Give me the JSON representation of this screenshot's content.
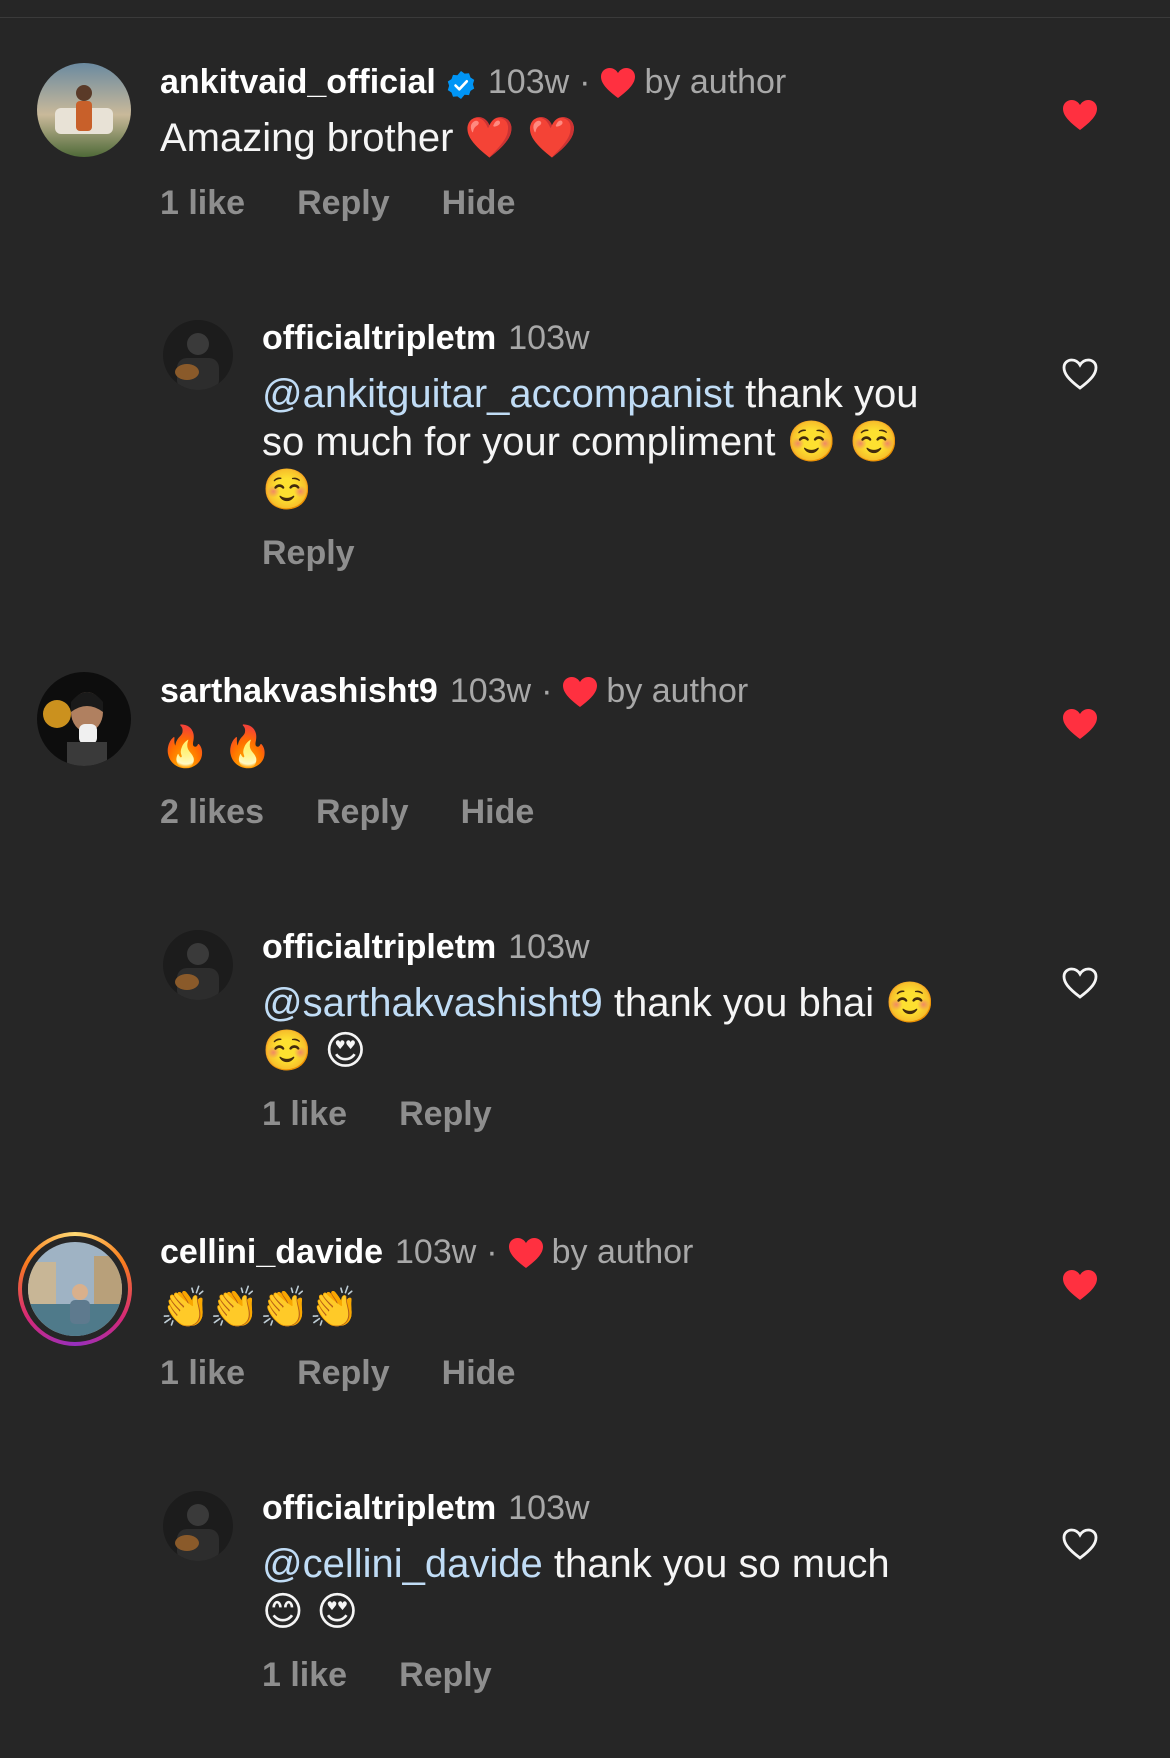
{
  "comments": [
    {
      "username": "ankitvaid_official",
      "verified": true,
      "time": "103w",
      "dot": "·",
      "by_author": "by author",
      "text": "Amazing brother",
      "emojis": "❤️ ❤️",
      "likes": "1 like",
      "reply": "Reply",
      "hide": "Hide",
      "liked": true,
      "replies": [
        {
          "username": "officialtripletm",
          "time": "103w",
          "mention": "@ankitguitar_accompanist",
          "text_line1": " thank you",
          "text_line2": "so much for your compliment",
          "emojis_line2": "☺️ ☺️",
          "emojis_line3": "☺️",
          "reply": "Reply",
          "liked": false
        }
      ]
    },
    {
      "username": "sarthakvashisht9",
      "time": "103w",
      "dot": "·",
      "by_author": "by author",
      "emojis": "🔥 🔥",
      "likes": "2 likes",
      "reply": "Reply",
      "hide": "Hide",
      "liked": true,
      "replies": [
        {
          "username": "officialtripletm",
          "time": "103w",
          "mention": "@sarthakvashisht9",
          "text_line1": " thank you bhai",
          "emojis_line1": "☺️",
          "emojis_line2": "☺️ 😍",
          "likes": "1 like",
          "reply": "Reply",
          "liked": false
        }
      ]
    },
    {
      "username": "cellini_davide",
      "time": "103w",
      "dot": "·",
      "by_author": "by author",
      "emojis": "👏👏👏👏",
      "likes": "1 like",
      "reply": "Reply",
      "hide": "Hide",
      "liked": true,
      "story_ring": true,
      "replies": [
        {
          "username": "officialtripletm",
          "time": "103w",
          "mention": "@cellini_davide",
          "text_line1": " thank you so much",
          "emojis_line2": "😊 😍",
          "likes": "1 like",
          "reply": "Reply",
          "liked": false
        }
      ]
    }
  ],
  "colors": {
    "background": "#262626",
    "heart_red": "#ff3040",
    "muted": "#a8a8a8",
    "verified_blue": "#0095f6"
  }
}
